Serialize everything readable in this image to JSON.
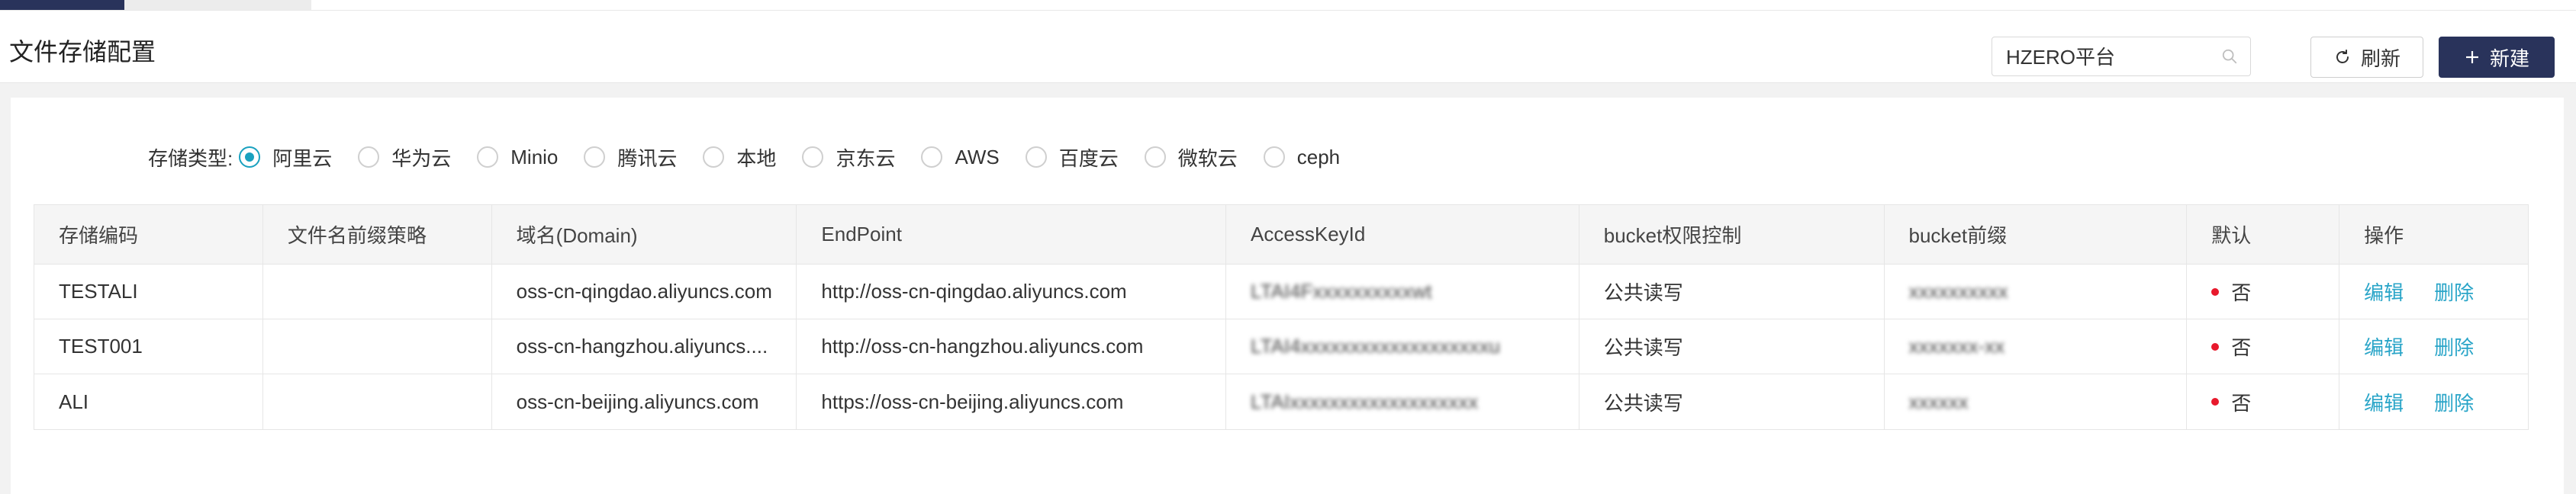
{
  "header": {
    "title": "文件存储配置",
    "search_value": "HZERO平台",
    "refresh_label": "刷新",
    "new_label": "新建"
  },
  "storage_type": {
    "label": "存储类型:",
    "options": [
      "阿里云",
      "华为云",
      "Minio",
      "腾讯云",
      "本地",
      "京东云",
      "AWS",
      "百度云",
      "微软云",
      "ceph"
    ],
    "selected": "阿里云"
  },
  "table": {
    "headers": [
      "存储编码",
      "文件名前缀策略",
      "域名(Domain)",
      "EndPoint",
      "AccessKeyId",
      "bucket权限控制",
      "bucket前缀",
      "默认",
      "操作"
    ],
    "rows": [
      {
        "code": "TESTALI",
        "prefix_strategy": "",
        "domain": "oss-cn-qingdao.aliyuncs.com",
        "endpoint": "http://oss-cn-qingdao.aliyuncs.com",
        "access_key": "LTAI4Fxxxxxxxxxxwt",
        "permission": "公共读写",
        "bucket_prefix": "xxxxxxxxxx",
        "default": "否",
        "edit": "编辑",
        "delete": "删除"
      },
      {
        "code": "TEST001",
        "prefix_strategy": "",
        "domain": "oss-cn-hangzhou.aliyuncs....",
        "endpoint": "http://oss-cn-hangzhou.aliyuncs.com",
        "access_key": "LTAI4xxxxxxxxxxxxxxxxxxxu",
        "permission": "公共读写",
        "bucket_prefix": "xxxxxxx-xx",
        "default": "否",
        "edit": "编辑",
        "delete": "删除"
      },
      {
        "code": "ALI",
        "prefix_strategy": "",
        "domain": "oss-cn-beijing.aliyuncs.com",
        "endpoint": "https://oss-cn-beijing.aliyuncs.com",
        "access_key": "LTAIxxxxxxxxxxxxxxxxxxx",
        "permission": "公共读写",
        "bucket_prefix": "xxxxxx",
        "default": "否",
        "edit": "编辑",
        "delete": "删除"
      }
    ]
  },
  "colors": {
    "primary": "#29335b",
    "accent": "#19a1bf",
    "link": "#2aa5c8",
    "status_dot": "#e8192c"
  }
}
